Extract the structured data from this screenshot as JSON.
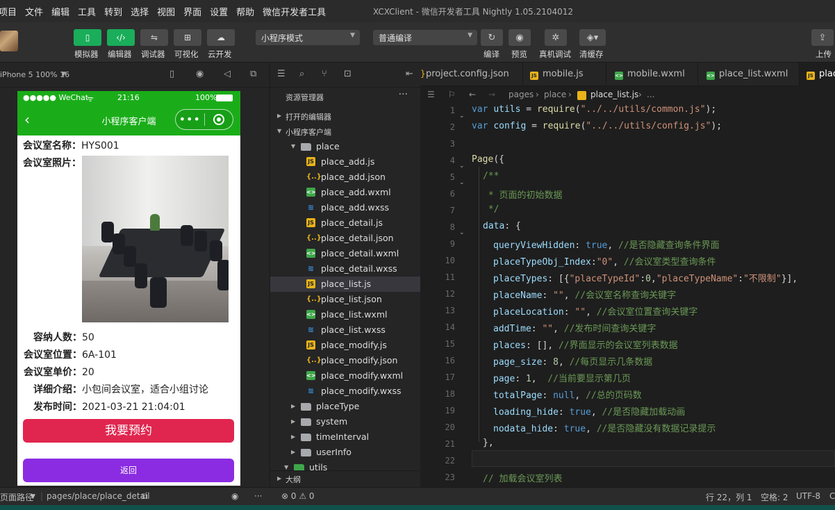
{
  "menubar": {
    "items": [
      "项目",
      "文件",
      "编辑",
      "工具",
      "转到",
      "选择",
      "视图",
      "界面",
      "设置",
      "帮助",
      "微信开发者工具"
    ],
    "window_title": "XCXClient - 微信开发者工具 Nightly 1.05.2104012"
  },
  "toolbar": {
    "view_buttons": [
      {
        "label": "模拟器",
        "icon": "phone-icon",
        "active": true
      },
      {
        "label": "编辑器",
        "icon": "code-icon",
        "active": true
      },
      {
        "label": "调试器",
        "icon": "debug-icon",
        "active": false
      },
      {
        "label": "可视化",
        "icon": "layout-icon",
        "active": false
      },
      {
        "label": "云开发",
        "icon": "cloud-icon",
        "active": false
      }
    ],
    "mode_select": "小程序模式",
    "compile_select": "普通编译",
    "actions": [
      {
        "label": "编译",
        "icon": "refresh-icon"
      },
      {
        "label": "预览",
        "icon": "eye-icon"
      },
      {
        "label": "真机调试",
        "icon": "bug-icon"
      },
      {
        "label": "清缓存",
        "icon": "layers-icon"
      }
    ],
    "upload_label": "上传"
  },
  "simulator": {
    "device": "iPhone 5 100% 16",
    "status": {
      "carrier": "●●●●● WeChat",
      "time": "21:16",
      "battery": "100%"
    },
    "nav_title": "小程序客户端",
    "fields": [
      {
        "label": "会议室名称：",
        "value": "HYS001"
      },
      {
        "label": "会议室照片：",
        "value": ""
      },
      {
        "label": "容纳人数：",
        "value": "50"
      },
      {
        "label": "会议室位置：",
        "value": "6A-101"
      },
      {
        "label": "会议室单价：",
        "value": "20"
      },
      {
        "label": "详细介绍：",
        "value": "小包间会议室，适合小组讨论"
      },
      {
        "label": "发布时间：",
        "value": "2021-03-21 21:04:01"
      }
    ],
    "book_button": "我要预约",
    "back_button": "返回"
  },
  "explorer": {
    "title": "资源管理器",
    "open_editors": "打开的编辑器",
    "project": "小程序客户端",
    "tree": [
      {
        "name": "place",
        "type": "folder",
        "depth": 1,
        "open": true
      },
      {
        "name": "place_add.js",
        "type": "js",
        "depth": 2
      },
      {
        "name": "place_add.json",
        "type": "json",
        "depth": 2
      },
      {
        "name": "place_add.wxml",
        "type": "wxml",
        "depth": 2
      },
      {
        "name": "place_add.wxss",
        "type": "wxss",
        "depth": 2
      },
      {
        "name": "place_detail.js",
        "type": "js",
        "depth": 2
      },
      {
        "name": "place_detail.json",
        "type": "json",
        "depth": 2
      },
      {
        "name": "place_detail.wxml",
        "type": "wxml",
        "depth": 2
      },
      {
        "name": "place_detail.wxss",
        "type": "wxss",
        "depth": 2
      },
      {
        "name": "place_list.js",
        "type": "js",
        "depth": 2,
        "selected": true
      },
      {
        "name": "place_list.json",
        "type": "json",
        "depth": 2
      },
      {
        "name": "place_list.wxml",
        "type": "wxml",
        "depth": 2
      },
      {
        "name": "place_list.wxss",
        "type": "wxss",
        "depth": 2
      },
      {
        "name": "place_modify.js",
        "type": "js",
        "depth": 2
      },
      {
        "name": "place_modify.json",
        "type": "json",
        "depth": 2
      },
      {
        "name": "place_modify.wxml",
        "type": "wxml",
        "depth": 2
      },
      {
        "name": "place_modify.wxss",
        "type": "wxss",
        "depth": 2
      },
      {
        "name": "placeType",
        "type": "folder",
        "depth": 1,
        "open": false
      },
      {
        "name": "system",
        "type": "folder",
        "depth": 1,
        "open": false
      },
      {
        "name": "timeInterval",
        "type": "folder",
        "depth": 1,
        "open": false
      },
      {
        "name": "userInfo",
        "type": "folder",
        "depth": 1,
        "open": false
      },
      {
        "name": "utils",
        "type": "folder",
        "depth": 0,
        "open": true
      }
    ],
    "outline": "大纲"
  },
  "editor": {
    "tabs": [
      {
        "name": "project.config.json",
        "type": "json"
      },
      {
        "name": "mobile.js",
        "type": "js"
      },
      {
        "name": "mobile.wxml",
        "type": "wxml"
      },
      {
        "name": "place_list.wxml",
        "type": "wxml"
      },
      {
        "name": "plac",
        "type": "js",
        "active": true
      }
    ],
    "breadcrumb": [
      "pages",
      "place",
      "place_list.js",
      "..."
    ],
    "line_numbers": [
      "1",
      "2",
      "3",
      "4",
      "5",
      "6",
      "7",
      "8",
      "9",
      "10",
      "11",
      "12",
      "13",
      "14",
      "15",
      "16",
      "17",
      "18",
      "19",
      "20",
      "21",
      "22",
      "23"
    ]
  },
  "statusbar": {
    "page_path_label": "页面路径",
    "page_path": "pages/place/place_detail",
    "problems": "⊗ 0 ⚠ 0",
    "cursor": "行 22，列 1",
    "spaces": "空格: 2",
    "encoding": "UTF-8",
    "trailing": "C"
  },
  "colors": {
    "wechat_green": "#1aad19",
    "book_button": "#e0264f",
    "back_button": "#8b2be2",
    "active_toolbar": "#1aad5a"
  }
}
